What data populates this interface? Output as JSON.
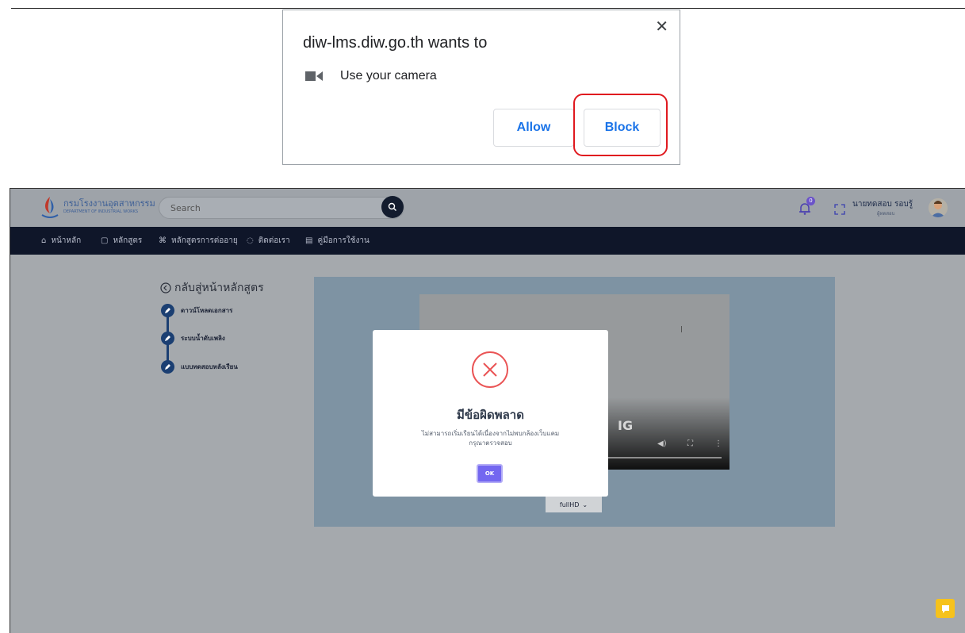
{
  "permission_prompt": {
    "title": "diw-lms.diw.go.th wants to",
    "close_glyph": "✕",
    "request_icon": "camera-icon",
    "request_text": "Use your camera",
    "allow_label": "Allow",
    "block_label": "Block",
    "highlight_color": "#e0191f",
    "button_text_color": "#1a73e8"
  },
  "app": {
    "logo": {
      "name": "กรมโรงงานอุตสาหกรรม",
      "subtitle": "DEPARTMENT OF INDUSTRIAL WORKS"
    },
    "search": {
      "placeholder": "Search"
    },
    "notifications": {
      "count": "0"
    },
    "user": {
      "name": "นายทดสอบ รอบรู้",
      "role": "ผู้ทดสอบ"
    },
    "nav": [
      {
        "icon": "⌂",
        "label": "หน้าหลัก"
      },
      {
        "icon": "▢",
        "label": "หลักสูตร"
      },
      {
        "icon": "⌘",
        "label": "หลักสูตรการต่ออายุ"
      },
      {
        "icon": "◌",
        "label": "ติดต่อเรา"
      },
      {
        "icon": "▤",
        "label": "คู่มือการใช้งาน"
      }
    ],
    "back_link": "กลับสู่หน้าหลักสูตร",
    "steps": [
      {
        "label": "ดาวน์โหลดเอกสาร"
      },
      {
        "label": "ระบบน้ำดับเพลิง"
      },
      {
        "label": "แบบทดสอบหลังเรียน"
      }
    ],
    "video": {
      "overlay_text": "IG",
      "quality": "fullHD"
    },
    "error_modal": {
      "title": "มีข้อผิดพลาด",
      "message_line1": "ไม่สามารถเริ่มเรียนได้เนื่องจากไม่พบกล้องเว็บแคม",
      "message_line2": "กรุณาตรวจสอบ",
      "ok_label": "OK",
      "accent": "#7367f0",
      "icon_color": "#ea5455"
    }
  }
}
